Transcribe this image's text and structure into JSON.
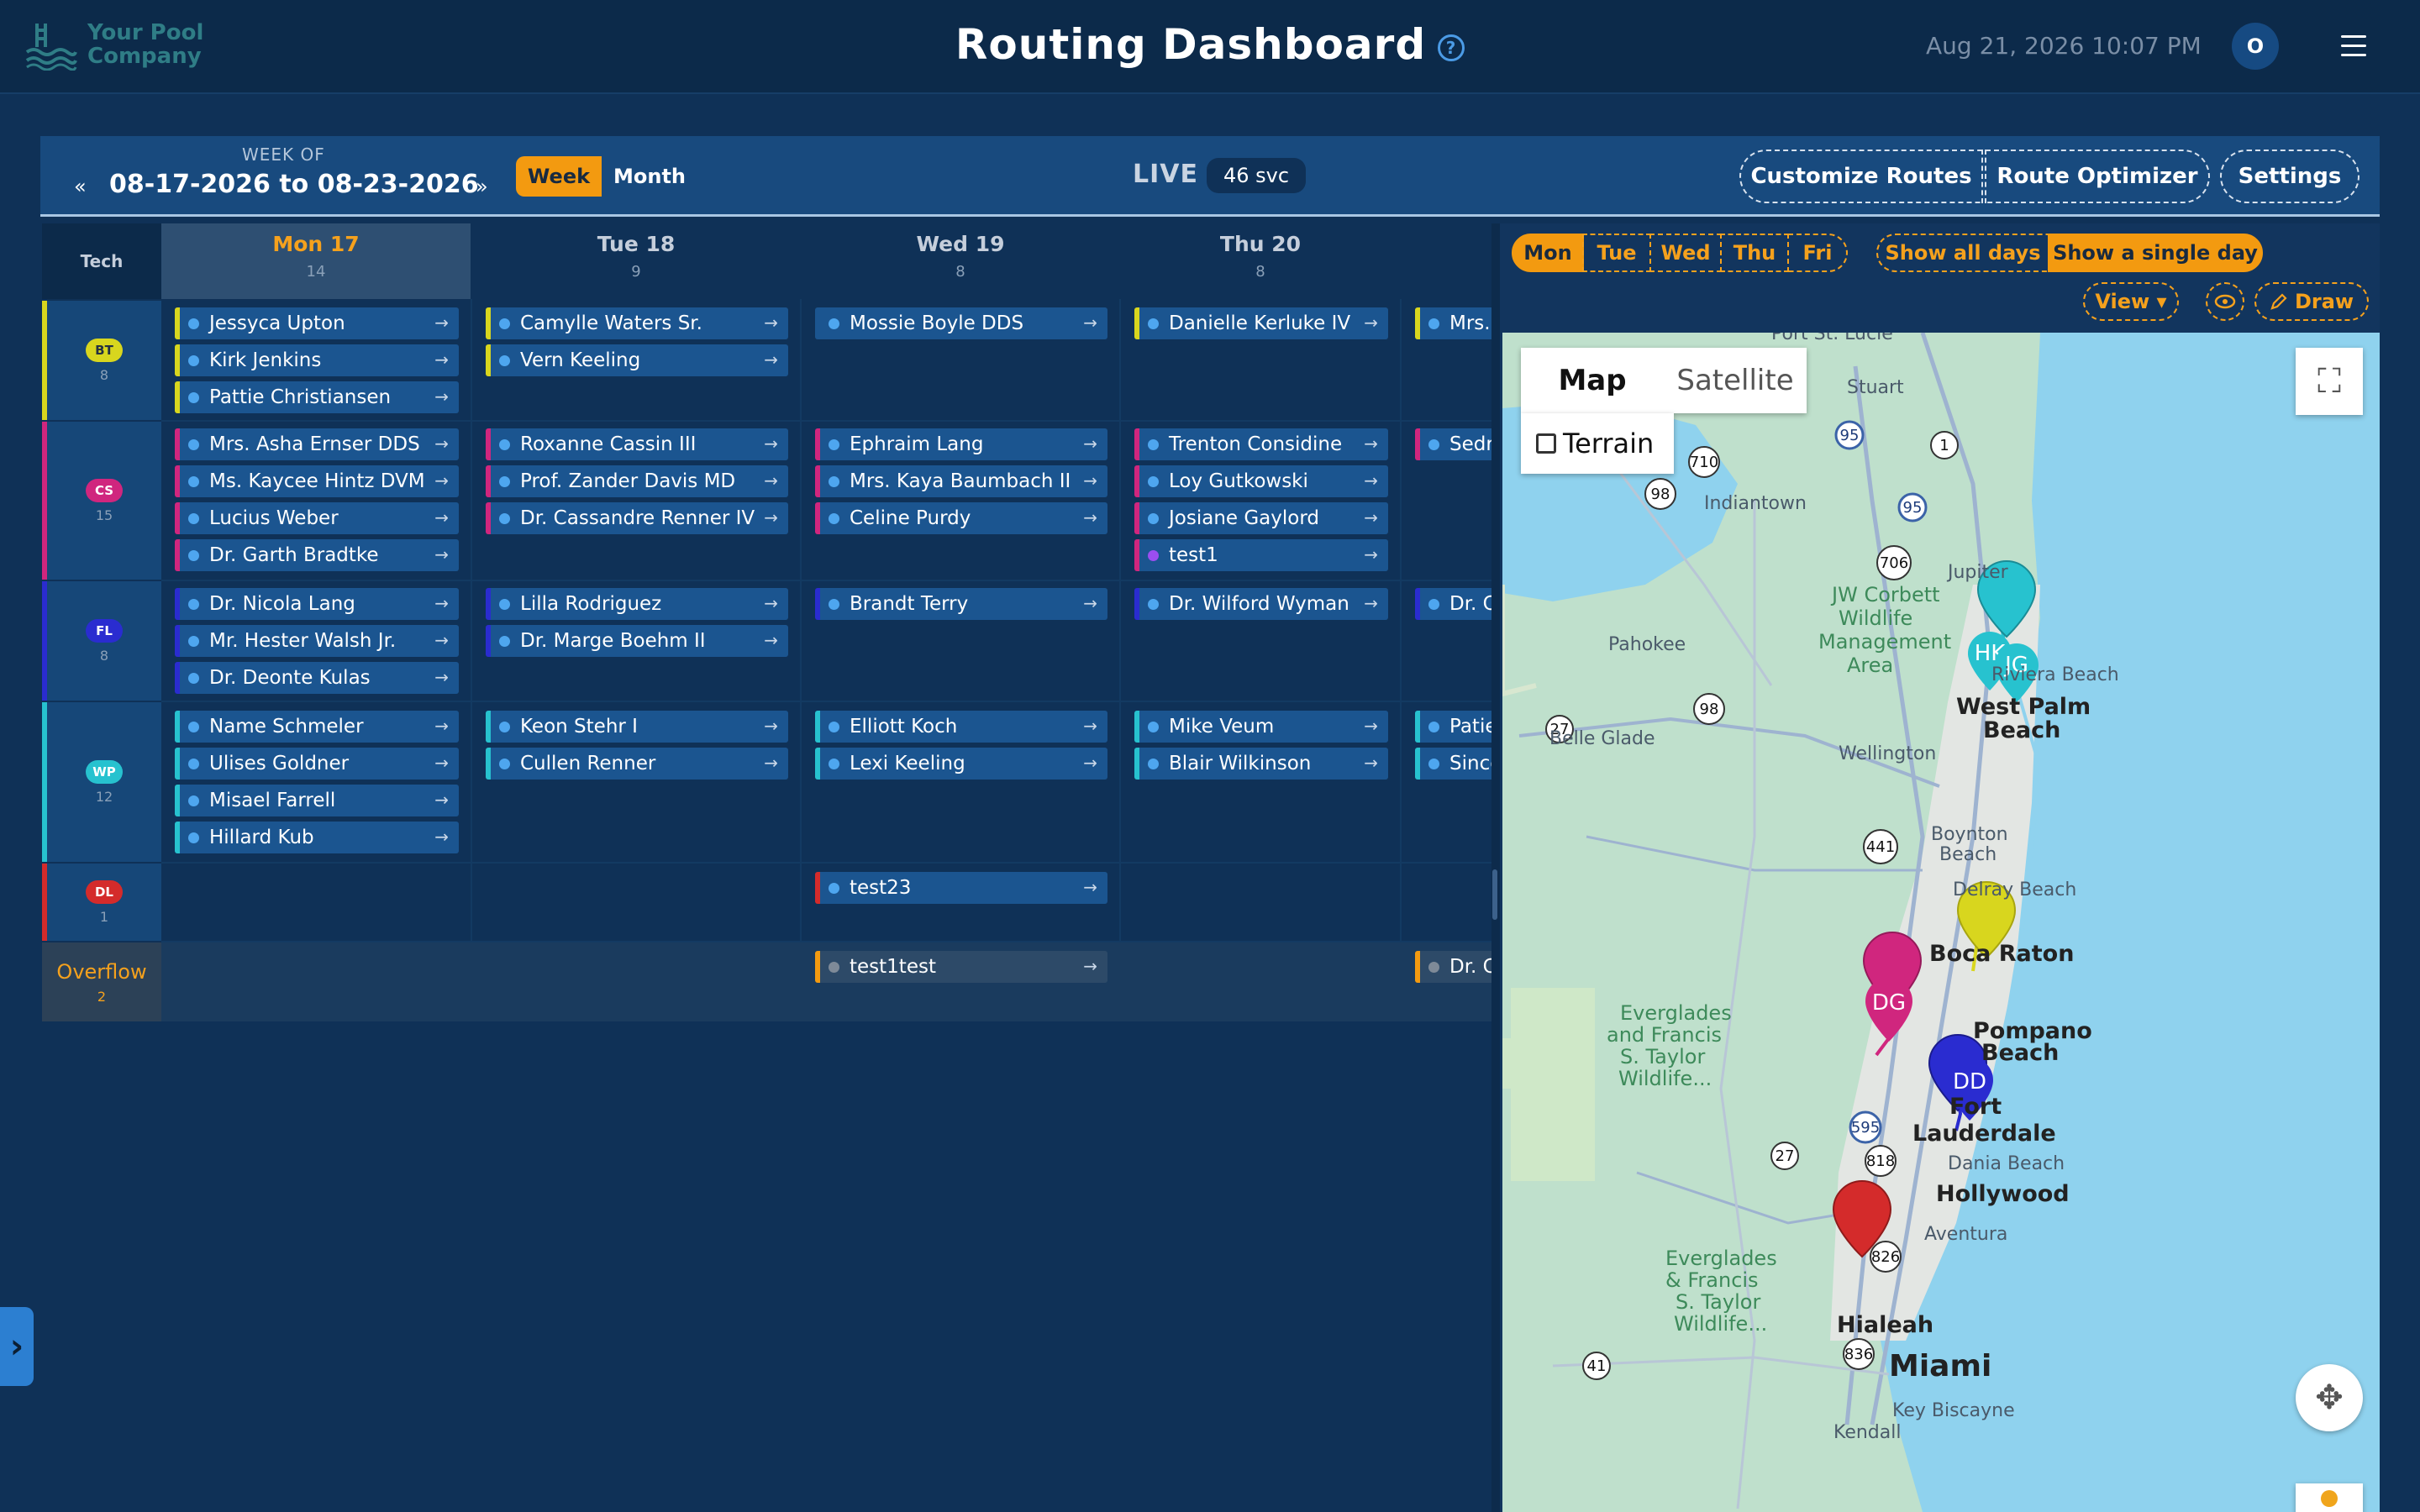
{
  "header": {
    "logo_line1": "Your Pool",
    "logo_line2": "Company",
    "title": "Routing Dashboard",
    "help": "?",
    "datetime": "Aug 21, 2026 10:07 PM",
    "avatar": "O"
  },
  "toolbar": {
    "week_of_label": "WEEK OF",
    "week_range": "08-17-2026 to 08-23-2026",
    "prev": "«",
    "next": "»",
    "view_week": "Week",
    "view_month": "Month",
    "live": "LIVE",
    "svc_count": "46 svc",
    "customize_routes": "Customize Routes",
    "route_optimizer": "Route Optimizer",
    "settings": "Settings"
  },
  "calendar": {
    "tech_header": "Tech",
    "days": [
      {
        "name": "Mon 17",
        "count": "14"
      },
      {
        "name": "Tue 18",
        "count": "9"
      },
      {
        "name": "Wed 19",
        "count": "8"
      },
      {
        "name": "Thu 20",
        "count": "8"
      }
    ],
    "techs": [
      {
        "badge": "BT",
        "count": "8",
        "color": "#d8d61e",
        "text": "#233042"
      },
      {
        "badge": "CS",
        "count": "15",
        "color": "#d0267e",
        "text": "#ffffff"
      },
      {
        "badge": "FL",
        "count": "8",
        "color": "#2a2cd0",
        "text": "#ffffff"
      },
      {
        "badge": "WP",
        "count": "12",
        "color": "#27c2cf",
        "text": "#ffffff"
      },
      {
        "badge": "DL",
        "count": "1",
        "color": "#d42b2b",
        "text": "#ffffff"
      }
    ],
    "overflow_label": "Overflow",
    "overflow_count": "2",
    "chips": {
      "bt": {
        "mon": [
          "Jessyca Upton",
          "Kirk Jenkins",
          "Pattie Christiansen"
        ],
        "tue": [
          "Camylle Waters Sr.",
          "Vern Keeling"
        ],
        "wed": [
          "Mossie Boyle DDS"
        ],
        "thu": [
          "Danielle Kerluke IV"
        ],
        "fri": [
          "Mrs."
        ]
      },
      "cs": {
        "mon": [
          "Mrs. Asha Ernser DDS",
          "Ms. Kaycee Hintz DVM",
          "Lucius Weber",
          "Dr. Garth Bradtke"
        ],
        "tue": [
          "Roxanne Cassin III",
          "Prof. Zander Davis MD",
          "Dr. Cassandre Renner IV"
        ],
        "wed": [
          "Ephraim Lang",
          "Mrs. Kaya Baumbach II",
          "Celine Purdy"
        ],
        "thu": [
          "Trenton Considine",
          "Loy Gutkowski",
          "Josiane Gaylord",
          "test1"
        ],
        "fri": [
          "Sedr"
        ]
      },
      "fl": {
        "mon": [
          "Dr. Nicola Lang",
          "Mr. Hester Walsh Jr.",
          "Dr. Deonte Kulas"
        ],
        "tue": [
          "Lilla Rodriguez",
          "Dr. Marge Boehm II"
        ],
        "wed": [
          "Brandt Terry"
        ],
        "thu": [
          "Dr. Wilford Wyman"
        ],
        "fri": [
          "Dr. C"
        ]
      },
      "wp": {
        "mon": [
          "Name Schmeler",
          "Ulises Goldner",
          "Misael Farrell",
          "Hillard Kub"
        ],
        "tue": [
          "Keon Stehr I",
          "Cullen Renner"
        ],
        "wed": [
          "Elliott Koch",
          "Lexi Keeling"
        ],
        "thu": [
          "Mike Veum",
          "Blair Wilkinson"
        ],
        "fri": [
          "Patie",
          "Since"
        ]
      },
      "dl": {
        "wed": [
          "test23"
        ]
      },
      "overflow": {
        "wed": [
          "test1test"
        ],
        "fri": [
          "Dr. C"
        ]
      }
    }
  },
  "panel": {
    "days": [
      "Mon",
      "Tue",
      "Wed",
      "Thu",
      "Fri"
    ],
    "show_all_days": "Show all days",
    "show_single_day": "Show a single day",
    "view": "View ▾",
    "draw": "Draw"
  },
  "map": {
    "type_map": "Map",
    "type_satellite": "Satellite",
    "terrain": "Terrain",
    "labels": [
      "Port St. Lucie",
      "Stuart",
      "Indiantown",
      "Jupiter",
      "JW Corbett",
      "Wildlife",
      "Management",
      "Area",
      "Pahokee",
      "West Palm",
      "Beach",
      "Belle Glade",
      "Wellington",
      "Boynton",
      "Beach",
      "Delray Beach",
      "Boca Raton",
      "Everglades",
      "and Francis",
      "S. Taylor",
      "Wildlife...",
      "Pompano",
      "Beach",
      "Fort",
      "Lauderdale",
      "Dania Beach",
      "Hollywood",
      "Aventura",
      "Everglades",
      "& Francis",
      "S. Taylor",
      "Wildlife...",
      "Hialeah",
      "Miami",
      "Key Biscayne",
      "Kendall",
      "Riviera Beach"
    ],
    "shields": [
      "95",
      "1",
      "710",
      "98",
      "95",
      "706",
      "98",
      "27",
      "441",
      "595",
      "27",
      "818",
      "826",
      "836",
      "41"
    ],
    "pin_labels": [
      "HK",
      "JG",
      "DG",
      "DD"
    ]
  }
}
